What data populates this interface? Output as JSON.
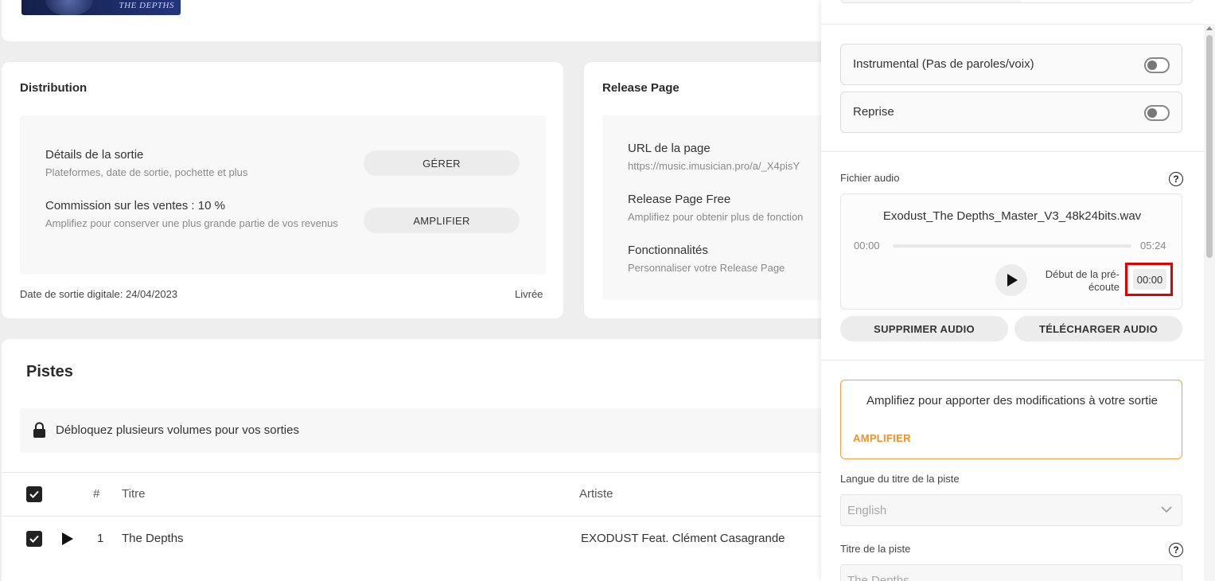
{
  "cover": {
    "text": "THE DEPTHS"
  },
  "distribution": {
    "title": "Distribution",
    "details_title": "Détails de la sortie",
    "details_sub": "Plateformes, date de sortie, pochette et plus",
    "manage_label": "GÉRER",
    "commission_title": "Commission sur les ventes : 10 %",
    "commission_sub": "Amplifiez pour conserver une plus grande partie de vos revenus",
    "amplify_label": "AMPLIFIER",
    "release_date": "Date de sortie digitale: 24/04/2023",
    "status": "Livrée"
  },
  "release_page": {
    "title": "Release Page",
    "url_title": "URL de la page",
    "url_value": "https://music.imusician.pro/a/_X4pisY",
    "free_title": "Release Page Free",
    "free_sub": "Amplifiez pour obtenir plus de fonction",
    "features_title": "Fonctionnalités",
    "features_sub": "Personnaliser votre Release Page"
  },
  "tracks": {
    "title": "Pistes",
    "unlock_text": "Débloquez plusieurs volumes pour vos sorties",
    "headers": {
      "number": "#",
      "title": "Titre",
      "artist": "Artiste"
    },
    "rows": [
      {
        "number": "1",
        "title": "The Depths",
        "artist": "EXODUST Feat. Clément Casagrande"
      }
    ]
  },
  "panel": {
    "instrumental_label": "Instrumental (Pas de paroles/voix)",
    "reprise_label": "Reprise",
    "audio_label": "Fichier audio",
    "audio_filename": "Exodust_The Depths_Master_V3_48k24bits.wav",
    "time_start": "00:00",
    "time_end": "05:24",
    "preview_label": "Début de la pré-écoute",
    "preview_value": "00:00",
    "delete_audio": "SUPPRIMER AUDIO",
    "download_audio": "TÉLÉCHARGER AUDIO",
    "amplify_message": "Amplifiez pour apporter des modifications à votre sortie",
    "amplify_link": "AMPLIFIER",
    "language_label": "Langue du titre de la piste",
    "language_value": "English",
    "track_title_label": "Titre de la piste",
    "track_title_value": "The Depths"
  },
  "colors": {
    "accent": "#f0902a",
    "highlight": "#e00000"
  }
}
